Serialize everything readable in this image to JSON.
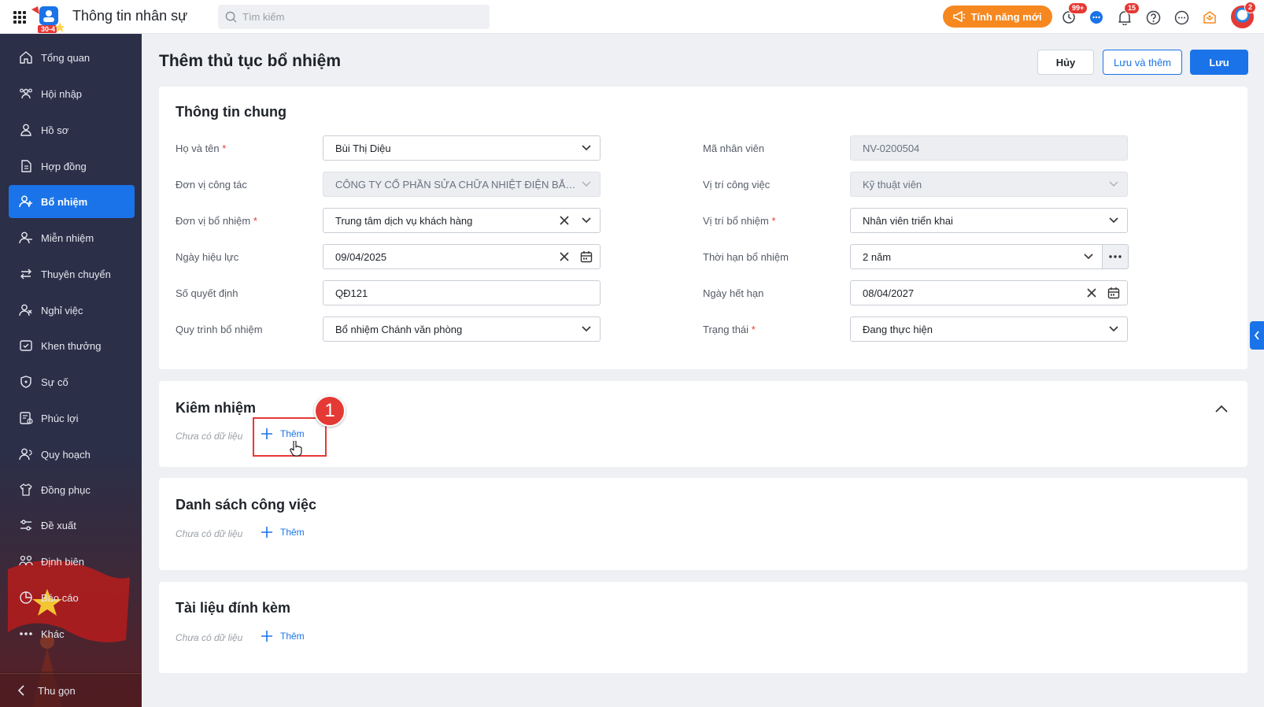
{
  "app": {
    "title": "Thông tin nhân sự",
    "logo_badge": "30-4",
    "search_placeholder": "Tìm kiếm",
    "new_feature_label": "Tính năng mới",
    "history_badge": "99+",
    "notification_badge": "15",
    "avatar_badge": "2"
  },
  "sidebar": {
    "items": [
      {
        "label": "Tổng quan",
        "icon": "home-icon"
      },
      {
        "label": "Hội nhập",
        "icon": "users-icon"
      },
      {
        "label": "Hồ sơ",
        "icon": "user-icon"
      },
      {
        "label": "Hợp đồng",
        "icon": "document-icon"
      },
      {
        "label": "Bổ nhiệm",
        "icon": "user-plus-icon"
      },
      {
        "label": "Miễn nhiệm",
        "icon": "user-minus-icon"
      },
      {
        "label": "Thuyên chuyển",
        "icon": "transfer-icon"
      },
      {
        "label": "Nghỉ việc",
        "icon": "user-x-icon"
      },
      {
        "label": "Khen thưởng",
        "icon": "award-icon"
      },
      {
        "label": "Sự cố",
        "icon": "shield-alert-icon"
      },
      {
        "label": "Phúc lợi",
        "icon": "benefit-icon"
      },
      {
        "label": "Quy hoạch",
        "icon": "plan-icon"
      },
      {
        "label": "Đồng phục",
        "icon": "shirt-icon"
      },
      {
        "label": "Đề xuất",
        "icon": "proposal-icon"
      },
      {
        "label": "Định biên",
        "icon": "headcount-icon"
      },
      {
        "label": "Báo cáo",
        "icon": "chart-pie-icon"
      },
      {
        "label": "Khác",
        "icon": "more-icon"
      }
    ],
    "active_index": 4,
    "collapse_label": "Thu gọn"
  },
  "page": {
    "title": "Thêm thủ tục bổ nhiệm",
    "cancel_label": "Hủy",
    "save_add_label": "Lưu và thêm",
    "save_label": "Lưu"
  },
  "general": {
    "title": "Thông tin chung",
    "full_name": {
      "label": "Họ và tên",
      "value": "Bùi Thị Diệu",
      "required": "*"
    },
    "work_unit": {
      "label": "Đơn vị công tác",
      "value": "CÔNG TY CỔ PHẦN SỬA CHỮA NHIỆT ĐIỆN BẮC ..."
    },
    "appoint_unit": {
      "label": "Đơn vị bổ nhiệm",
      "value": "Trung tâm dịch vụ khách hàng",
      "required": "*"
    },
    "effective_date": {
      "label": "Ngày hiệu lực",
      "value": "09/04/2025"
    },
    "decision_no": {
      "label": "Số quyết định",
      "value": "QĐ121"
    },
    "process": {
      "label": "Quy trình bổ nhiệm",
      "value": "Bổ nhiệm Chánh văn phòng"
    },
    "employee_code": {
      "label": "Mã nhân viên",
      "value": "NV-0200504"
    },
    "job_position": {
      "label": "Vị trí công việc",
      "value": "Kỹ thuật viên"
    },
    "appoint_position": {
      "label": "Vị trí bổ nhiệm",
      "value": "Nhân viên triển khai",
      "required": "*"
    },
    "term": {
      "label": "Thời hạn bổ nhiệm",
      "value": "2 năm"
    },
    "expiry_date": {
      "label": "Ngày hết hạn",
      "value": "08/04/2027"
    },
    "status": {
      "label": "Trạng thái",
      "value": "Đang thực hiện",
      "required": "*"
    }
  },
  "concurrent": {
    "title": "Kiêm nhiệm",
    "empty": "Chưa có dữ liệu",
    "add_label": "Thêm",
    "step": "1"
  },
  "tasks": {
    "title": "Danh sách công việc",
    "empty": "Chưa có dữ liệu",
    "add_label": "Thêm"
  },
  "attachments": {
    "title": "Tài liệu đính kèm",
    "empty": "Chưa có dữ liệu",
    "add_label": "Thêm"
  },
  "colors": {
    "primary": "#1a73e8",
    "sidebar": "#2b2f48",
    "accent_orange": "#f6881f",
    "highlight_red": "#e53935"
  }
}
